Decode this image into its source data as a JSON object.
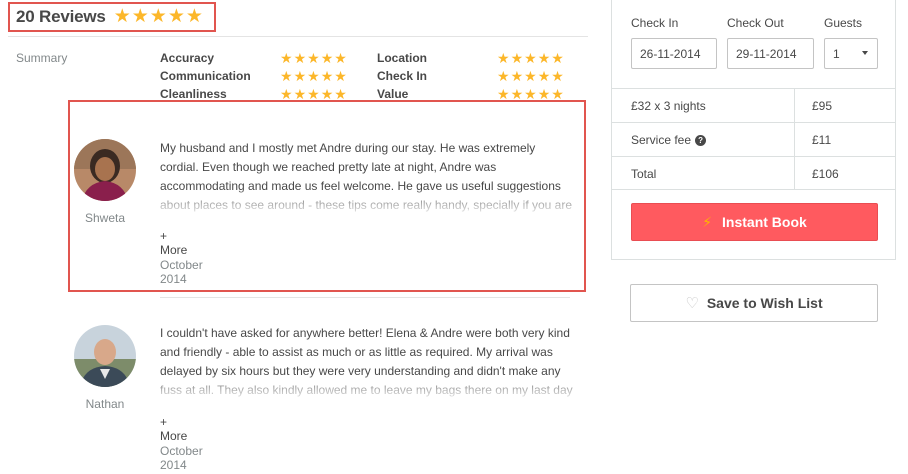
{
  "reviews_header": {
    "title": "20 Reviews",
    "stars": 5
  },
  "summary": {
    "label": "Summary",
    "categories": [
      {
        "name": "Accuracy",
        "stars": 5
      },
      {
        "name": "Communication",
        "stars": 5
      },
      {
        "name": "Cleanliness",
        "stars": 5
      },
      {
        "name": "Location",
        "stars": 5
      },
      {
        "name": "Check In",
        "stars": 5
      },
      {
        "name": "Value",
        "stars": 5
      }
    ]
  },
  "reviews": [
    {
      "name": "Shweta",
      "text": "My husband and I mostly met Andre during our stay. He was extremely cordial. Even though we reached pretty late at night, Andre was accommodating and made us feel welcome. He gave us useful suggestions about places to see around - these tips come really handy, specially if you are visiting Rome for the first time.",
      "more": "+ More",
      "date": "October 2014"
    },
    {
      "name": "Nathan",
      "text": "I couldn't have asked for anywhere better! Elena & Andre were both very kind and friendly - able to assist as much or as little as required. My arrival was delayed by six hours but they were very understanding and didn't make any fuss at all. They also kindly allowed me to leave my bags there on my last day as I needed to be around in the city.",
      "more": "+ More",
      "date": "October 2014"
    }
  ],
  "booking": {
    "check_in_label": "Check In",
    "check_out_label": "Check Out",
    "guests_label": "Guests",
    "check_in_value": "26-11-2014",
    "check_out_value": "29-11-2014",
    "guests_value": "1",
    "rows": [
      {
        "label": "£32 x 3 nights",
        "value": "£95",
        "help": false
      },
      {
        "label": "Service fee",
        "value": "£11",
        "help": true
      },
      {
        "label": "Total",
        "value": "£106",
        "help": false
      }
    ],
    "instant_book_label": "Instant Book"
  },
  "wish_list_label": "Save to Wish List",
  "colors": {
    "accent": "#ff5a5f",
    "star": "#fcb72a",
    "highlight": "#e1554f"
  },
  "icons": {
    "star": "star-icon",
    "bolt": "lightning-bolt-icon",
    "heart": "heart-icon",
    "help": "question-circle-icon",
    "caret": "chevron-down-icon"
  }
}
